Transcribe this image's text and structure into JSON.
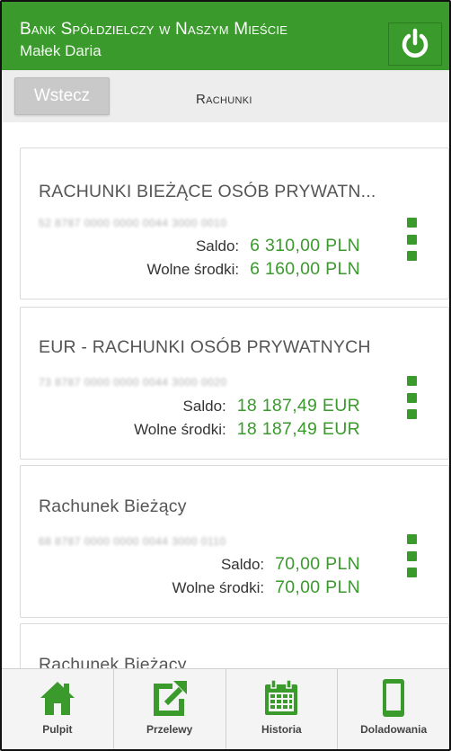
{
  "header": {
    "bank_name": "Bank Spółdzielczy w Naszym Mieście",
    "user_name": "Małek Daria",
    "power_icon": "power-icon"
  },
  "navbar": {
    "back_label": "Wstecz",
    "title": "Rachunki"
  },
  "accounts": [
    {
      "name": "RACHUNKI BIEŻĄCE OSÓB PRYWATN...",
      "number": "52 8787 0000 0000 0044 3000 0010",
      "saldo_label": "Saldo:",
      "saldo": "6 310,00 PLN",
      "wolne_label": "Wolne środki:",
      "wolne": "6 160,00 PLN"
    },
    {
      "name": "EUR - RACHUNKI OSÓB PRYWATNYCH",
      "number": "73 8787 0000 0000 0044 3000 0020",
      "saldo_label": "Saldo:",
      "saldo": "18 187,49 EUR",
      "wolne_label": "Wolne środki:",
      "wolne": "18 187,49 EUR"
    },
    {
      "name": "Rachunek Bieżący",
      "number": "68 8787 0000 0000 0044 3000 0110",
      "saldo_label": "Saldo:",
      "saldo": "70,00 PLN",
      "wolne_label": "Wolne środki:",
      "wolne": "70,00 PLN"
    },
    {
      "name": "Rachunek Bieżący"
    }
  ],
  "toolbar": [
    {
      "label": "Pulpit",
      "icon": "home-icon"
    },
    {
      "label": "Przelewy",
      "icon": "external-link-icon"
    },
    {
      "label": "Historia",
      "icon": "calendar-icon"
    },
    {
      "label": "Doladowania",
      "icon": "phone-icon"
    }
  ],
  "colors": {
    "brand_green": "#3a9a2c",
    "navbar_bg": "#ededed",
    "back_button_bg": "#c9c9c9"
  }
}
